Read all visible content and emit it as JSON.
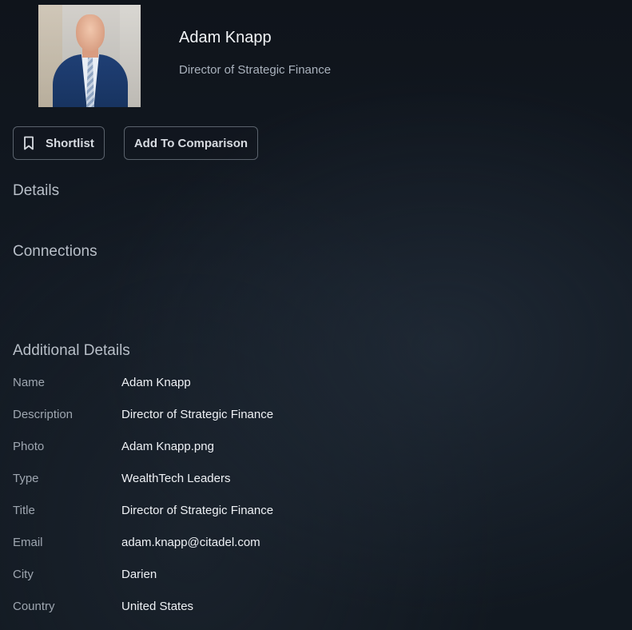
{
  "profile": {
    "name": "Adam Knapp",
    "subtitle": "Director of Strategic Finance",
    "photo_icon": "profile-photo"
  },
  "actions": {
    "shortlist_label": "Shortlist",
    "compare_label": "Add To Comparison",
    "shortlist_icon": "bookmark-icon"
  },
  "sections": {
    "details": "Details",
    "connections": "Connections",
    "additional": "Additional Details"
  },
  "additional_details": [
    {
      "label": "Name",
      "value": "Adam Knapp"
    },
    {
      "label": "Description",
      "value": "Director of Strategic Finance"
    },
    {
      "label": "Photo",
      "value": "Adam Knapp.png"
    },
    {
      "label": "Type",
      "value": "WealthTech Leaders"
    },
    {
      "label": "Title",
      "value": "Director of Strategic Finance"
    },
    {
      "label": "Email",
      "value": "adam.knapp@citadel.com"
    },
    {
      "label": "City",
      "value": "Darien"
    },
    {
      "label": "Country",
      "value": "United States"
    }
  ],
  "colors": {
    "background": "#111820",
    "text_primary": "#eef1f5",
    "text_secondary": "#9ea6b0",
    "button_border": "#5b636d"
  }
}
